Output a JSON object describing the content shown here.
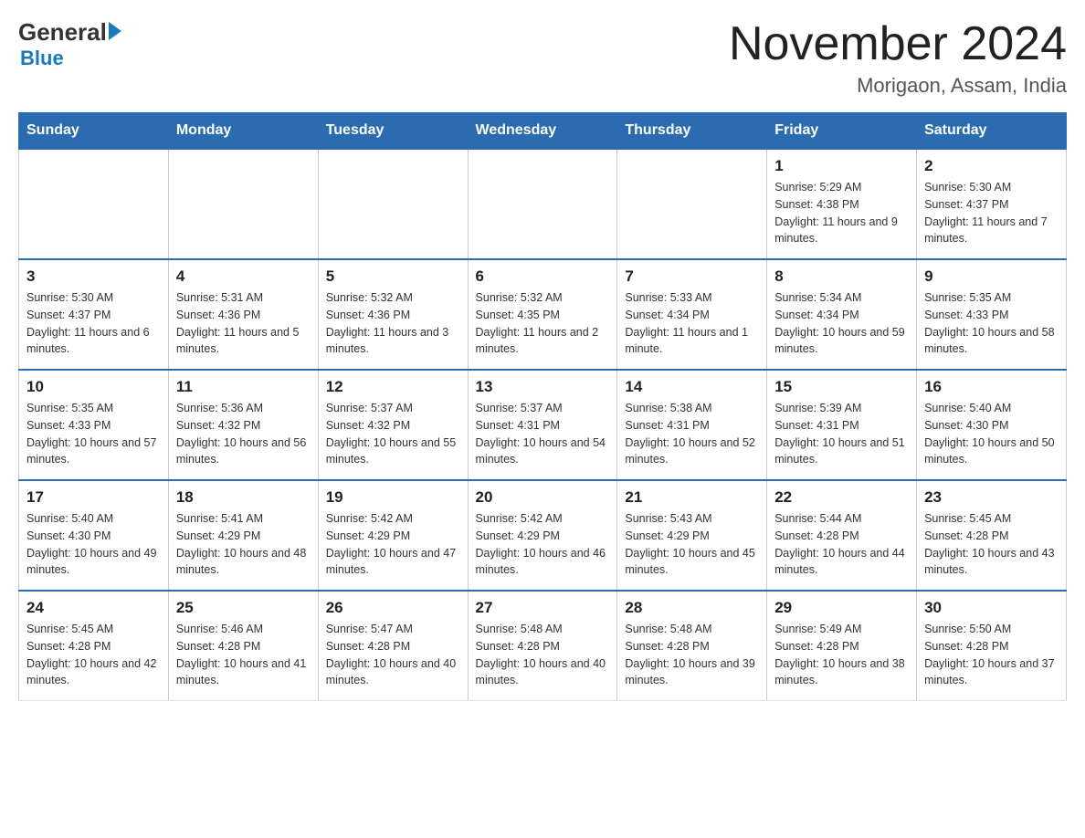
{
  "logo": {
    "general": "General",
    "blue": "Blue"
  },
  "header": {
    "month_year": "November 2024",
    "location": "Morigaon, Assam, India"
  },
  "weekdays": [
    "Sunday",
    "Monday",
    "Tuesday",
    "Wednesday",
    "Thursday",
    "Friday",
    "Saturday"
  ],
  "weeks": [
    [
      {
        "day": "",
        "info": ""
      },
      {
        "day": "",
        "info": ""
      },
      {
        "day": "",
        "info": ""
      },
      {
        "day": "",
        "info": ""
      },
      {
        "day": "",
        "info": ""
      },
      {
        "day": "1",
        "info": "Sunrise: 5:29 AM\nSunset: 4:38 PM\nDaylight: 11 hours and 9 minutes."
      },
      {
        "day": "2",
        "info": "Sunrise: 5:30 AM\nSunset: 4:37 PM\nDaylight: 11 hours and 7 minutes."
      }
    ],
    [
      {
        "day": "3",
        "info": "Sunrise: 5:30 AM\nSunset: 4:37 PM\nDaylight: 11 hours and 6 minutes."
      },
      {
        "day": "4",
        "info": "Sunrise: 5:31 AM\nSunset: 4:36 PM\nDaylight: 11 hours and 5 minutes."
      },
      {
        "day": "5",
        "info": "Sunrise: 5:32 AM\nSunset: 4:36 PM\nDaylight: 11 hours and 3 minutes."
      },
      {
        "day": "6",
        "info": "Sunrise: 5:32 AM\nSunset: 4:35 PM\nDaylight: 11 hours and 2 minutes."
      },
      {
        "day": "7",
        "info": "Sunrise: 5:33 AM\nSunset: 4:34 PM\nDaylight: 11 hours and 1 minute."
      },
      {
        "day": "8",
        "info": "Sunrise: 5:34 AM\nSunset: 4:34 PM\nDaylight: 10 hours and 59 minutes."
      },
      {
        "day": "9",
        "info": "Sunrise: 5:35 AM\nSunset: 4:33 PM\nDaylight: 10 hours and 58 minutes."
      }
    ],
    [
      {
        "day": "10",
        "info": "Sunrise: 5:35 AM\nSunset: 4:33 PM\nDaylight: 10 hours and 57 minutes."
      },
      {
        "day": "11",
        "info": "Sunrise: 5:36 AM\nSunset: 4:32 PM\nDaylight: 10 hours and 56 minutes."
      },
      {
        "day": "12",
        "info": "Sunrise: 5:37 AM\nSunset: 4:32 PM\nDaylight: 10 hours and 55 minutes."
      },
      {
        "day": "13",
        "info": "Sunrise: 5:37 AM\nSunset: 4:31 PM\nDaylight: 10 hours and 54 minutes."
      },
      {
        "day": "14",
        "info": "Sunrise: 5:38 AM\nSunset: 4:31 PM\nDaylight: 10 hours and 52 minutes."
      },
      {
        "day": "15",
        "info": "Sunrise: 5:39 AM\nSunset: 4:31 PM\nDaylight: 10 hours and 51 minutes."
      },
      {
        "day": "16",
        "info": "Sunrise: 5:40 AM\nSunset: 4:30 PM\nDaylight: 10 hours and 50 minutes."
      }
    ],
    [
      {
        "day": "17",
        "info": "Sunrise: 5:40 AM\nSunset: 4:30 PM\nDaylight: 10 hours and 49 minutes."
      },
      {
        "day": "18",
        "info": "Sunrise: 5:41 AM\nSunset: 4:29 PM\nDaylight: 10 hours and 48 minutes."
      },
      {
        "day": "19",
        "info": "Sunrise: 5:42 AM\nSunset: 4:29 PM\nDaylight: 10 hours and 47 minutes."
      },
      {
        "day": "20",
        "info": "Sunrise: 5:42 AM\nSunset: 4:29 PM\nDaylight: 10 hours and 46 minutes."
      },
      {
        "day": "21",
        "info": "Sunrise: 5:43 AM\nSunset: 4:29 PM\nDaylight: 10 hours and 45 minutes."
      },
      {
        "day": "22",
        "info": "Sunrise: 5:44 AM\nSunset: 4:28 PM\nDaylight: 10 hours and 44 minutes."
      },
      {
        "day": "23",
        "info": "Sunrise: 5:45 AM\nSunset: 4:28 PM\nDaylight: 10 hours and 43 minutes."
      }
    ],
    [
      {
        "day": "24",
        "info": "Sunrise: 5:45 AM\nSunset: 4:28 PM\nDaylight: 10 hours and 42 minutes."
      },
      {
        "day": "25",
        "info": "Sunrise: 5:46 AM\nSunset: 4:28 PM\nDaylight: 10 hours and 41 minutes."
      },
      {
        "day": "26",
        "info": "Sunrise: 5:47 AM\nSunset: 4:28 PM\nDaylight: 10 hours and 40 minutes."
      },
      {
        "day": "27",
        "info": "Sunrise: 5:48 AM\nSunset: 4:28 PM\nDaylight: 10 hours and 40 minutes."
      },
      {
        "day": "28",
        "info": "Sunrise: 5:48 AM\nSunset: 4:28 PM\nDaylight: 10 hours and 39 minutes."
      },
      {
        "day": "29",
        "info": "Sunrise: 5:49 AM\nSunset: 4:28 PM\nDaylight: 10 hours and 38 minutes."
      },
      {
        "day": "30",
        "info": "Sunrise: 5:50 AM\nSunset: 4:28 PM\nDaylight: 10 hours and 37 minutes."
      }
    ]
  ]
}
